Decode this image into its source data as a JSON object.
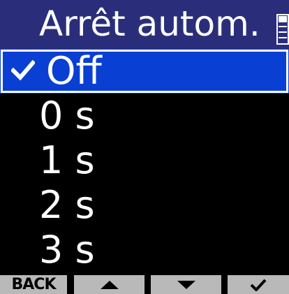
{
  "header": {
    "title": "Arrêt autom.",
    "scroll_icon": "scroll-indicator-icon"
  },
  "menu": {
    "items": [
      {
        "label": "Off",
        "selected": true,
        "checked": true
      },
      {
        "label": "0 s",
        "selected": false,
        "checked": false
      },
      {
        "label": "1 s",
        "selected": false,
        "checked": false
      },
      {
        "label": "2 s",
        "selected": false,
        "checked": false
      },
      {
        "label": "3 s",
        "selected": false,
        "checked": false
      }
    ]
  },
  "softkeys": {
    "back_label": "BACK",
    "up_icon": "arrow-up-icon",
    "down_icon": "arrow-down-icon",
    "enter_icon": "checkmark-icon"
  },
  "colors": {
    "title_bar": "#2a2e7a",
    "selected_row": "#0a3fd4",
    "softkey_bg": "#b9b9b9",
    "background": "#000000",
    "text": "#ffffff"
  }
}
